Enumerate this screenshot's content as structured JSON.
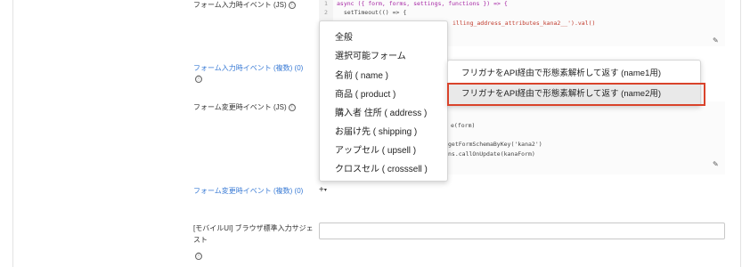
{
  "fields": {
    "form_input_event_label": "フォーム入力時イベント (JS)",
    "form_input_event_multi_label": "フォーム入力時イベント (複数) (0)",
    "form_change_event_label": "フォーム変更時イベント (JS)",
    "form_change_event_multi_label": "フォーム変更時イベント (複数) (0)",
    "mobile_autosuggest_label": "[モバイルUI] ブラウザ標準入力サジェスト",
    "info_icon": "ⓘ",
    "add_button": "+",
    "add_caret": "▾",
    "edit_icon": "✎"
  },
  "code_editor": {
    "line_numbers": [
      "1",
      "2"
    ],
    "lines": [
      "async ({ form, forms, settings, functions }) => {",
      "  setTimeout(() => {",
      "illing_address_attributes_kana2__').val()"
    ],
    "change_lines": [
      "e(form)",
      "getFormSchemaByKey('kana2')",
      "ns.callOnUpdate(kanaForm)"
    ]
  },
  "dropdown_menu": {
    "items": [
      "全般",
      "選択可能フォーム",
      "名前 ( name )",
      "商品 ( product )",
      "購入者 住所 ( address )",
      "お届け先 ( shipping )",
      "アップセル ( upsell )",
      "クロスセル ( crosssell )"
    ]
  },
  "submenu": {
    "items": [
      "フリガナをAPI経由で形態素解析して返す (name1用)",
      "フリガナをAPI経由で形態素解析して返す (name2用)"
    ],
    "selected_index": 1
  },
  "colors": {
    "link": "#3a7bd5",
    "highlight": "#d9432b",
    "selected_bg": "#e9e9e9"
  }
}
